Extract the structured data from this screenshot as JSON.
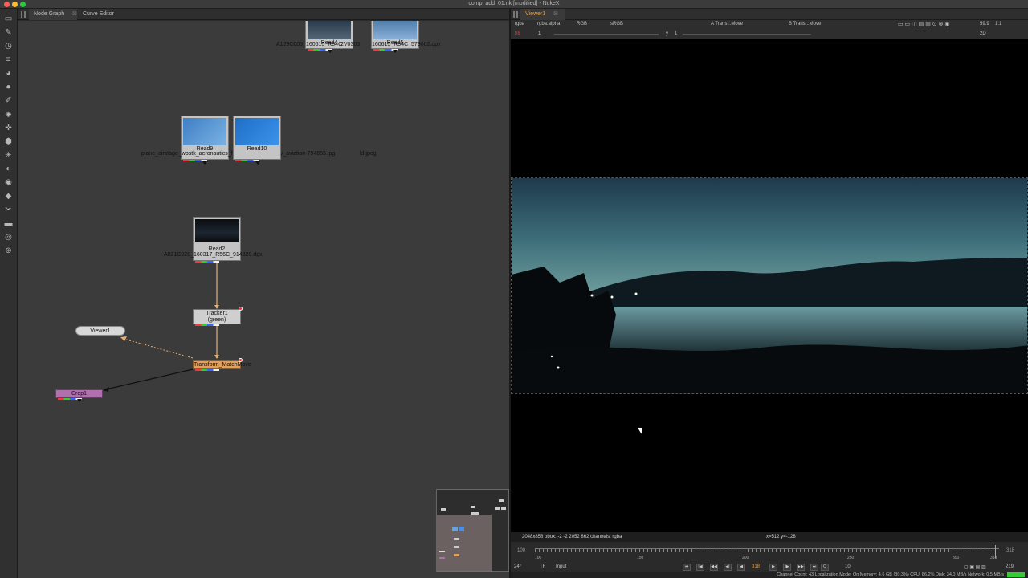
{
  "window": {
    "title": "comp_add_01.nk [modified] - NukeX"
  },
  "colors": {
    "accent": "#f09a30",
    "transform": "#e0a060",
    "crop": "#b070b0",
    "statusbar_ok": "#33cc33"
  },
  "node_graph_pane": {
    "tabs": [
      {
        "label": "Node Graph",
        "close": "⊠"
      },
      {
        "label": "Curve Editor",
        "close": "⊠"
      }
    ],
    "nodes": {
      "read4": {
        "name": "Read4",
        "file": "A129C003_160615_R54C"
      },
      "read4_overlap": "2V0303",
      "read5": {
        "name": "Read5",
        "file": "160615_R54C_579002.dpx"
      },
      "read9": {
        "name": "Read9",
        "file": "plane_airstage_wbstk_aeronautics_fly_air_transport_sky_aviation-794655.jpg"
      },
      "read10": {
        "name": "Read10",
        "file": "ld.jpeg"
      },
      "read2": {
        "name": "Read2",
        "file": "A021C028_160317_R56C_914320.dpx"
      },
      "tracker1": {
        "name": "Tracker1",
        "sub": "(green)"
      },
      "transform": {
        "name": "Transform_MatchMove"
      },
      "viewer1": {
        "name": "Viewer1"
      },
      "crop1": {
        "name": "Crop1"
      }
    }
  },
  "toolbar": {
    "icons": [
      "image-icon",
      "draw-icon",
      "time-icon",
      "channel-icon",
      "color-icon",
      "filter-icon",
      "keyer-icon",
      "merge-icon",
      "transform-icon",
      "3d-icon",
      "particles-icon",
      "deep-icon",
      "views-icon",
      "metadata-icon",
      "toolsets-icon",
      "other-icon",
      "furnace-icon",
      "plugins-icon"
    ]
  },
  "viewer_pane": {
    "tab": {
      "label": "Viewer1",
      "close": "⊠"
    },
    "row1": {
      "layer": "rgba",
      "channel": "rgba.alpha",
      "display": "RGB",
      "lut": "sRGB",
      "input_a": "A  Trans...Move",
      "input_b": "B  Trans...Move",
      "zoom_fps": "59.9",
      "zoom_ratio": "1:1"
    },
    "row2": {
      "fstop_label": "f/8",
      "gain": "1",
      "gamma_label": "y",
      "gamma": "1",
      "view_mode": "2D"
    },
    "info": {
      "format": "2048x858  bbox: -2 -2 2052 862 channels: rgba",
      "coords": "x=512 y=-128"
    },
    "timeline": {
      "start": "100",
      "end": "318",
      "ticks": [
        "100",
        "150",
        "200",
        "250",
        "300",
        "318"
      ],
      "current_frame": "318"
    },
    "controls": {
      "fps": "24*",
      "tf": "TF",
      "input": "Input",
      "frame": "318",
      "increment": "10",
      "end_frame": "219"
    },
    "status": "Channel Count: 43  Localization Mode: On  Memory: 4.6 GB (30.3%)  CPU: 86.2%  Disk: 34.0 MB/s  Network: 0.5 MB/s"
  }
}
